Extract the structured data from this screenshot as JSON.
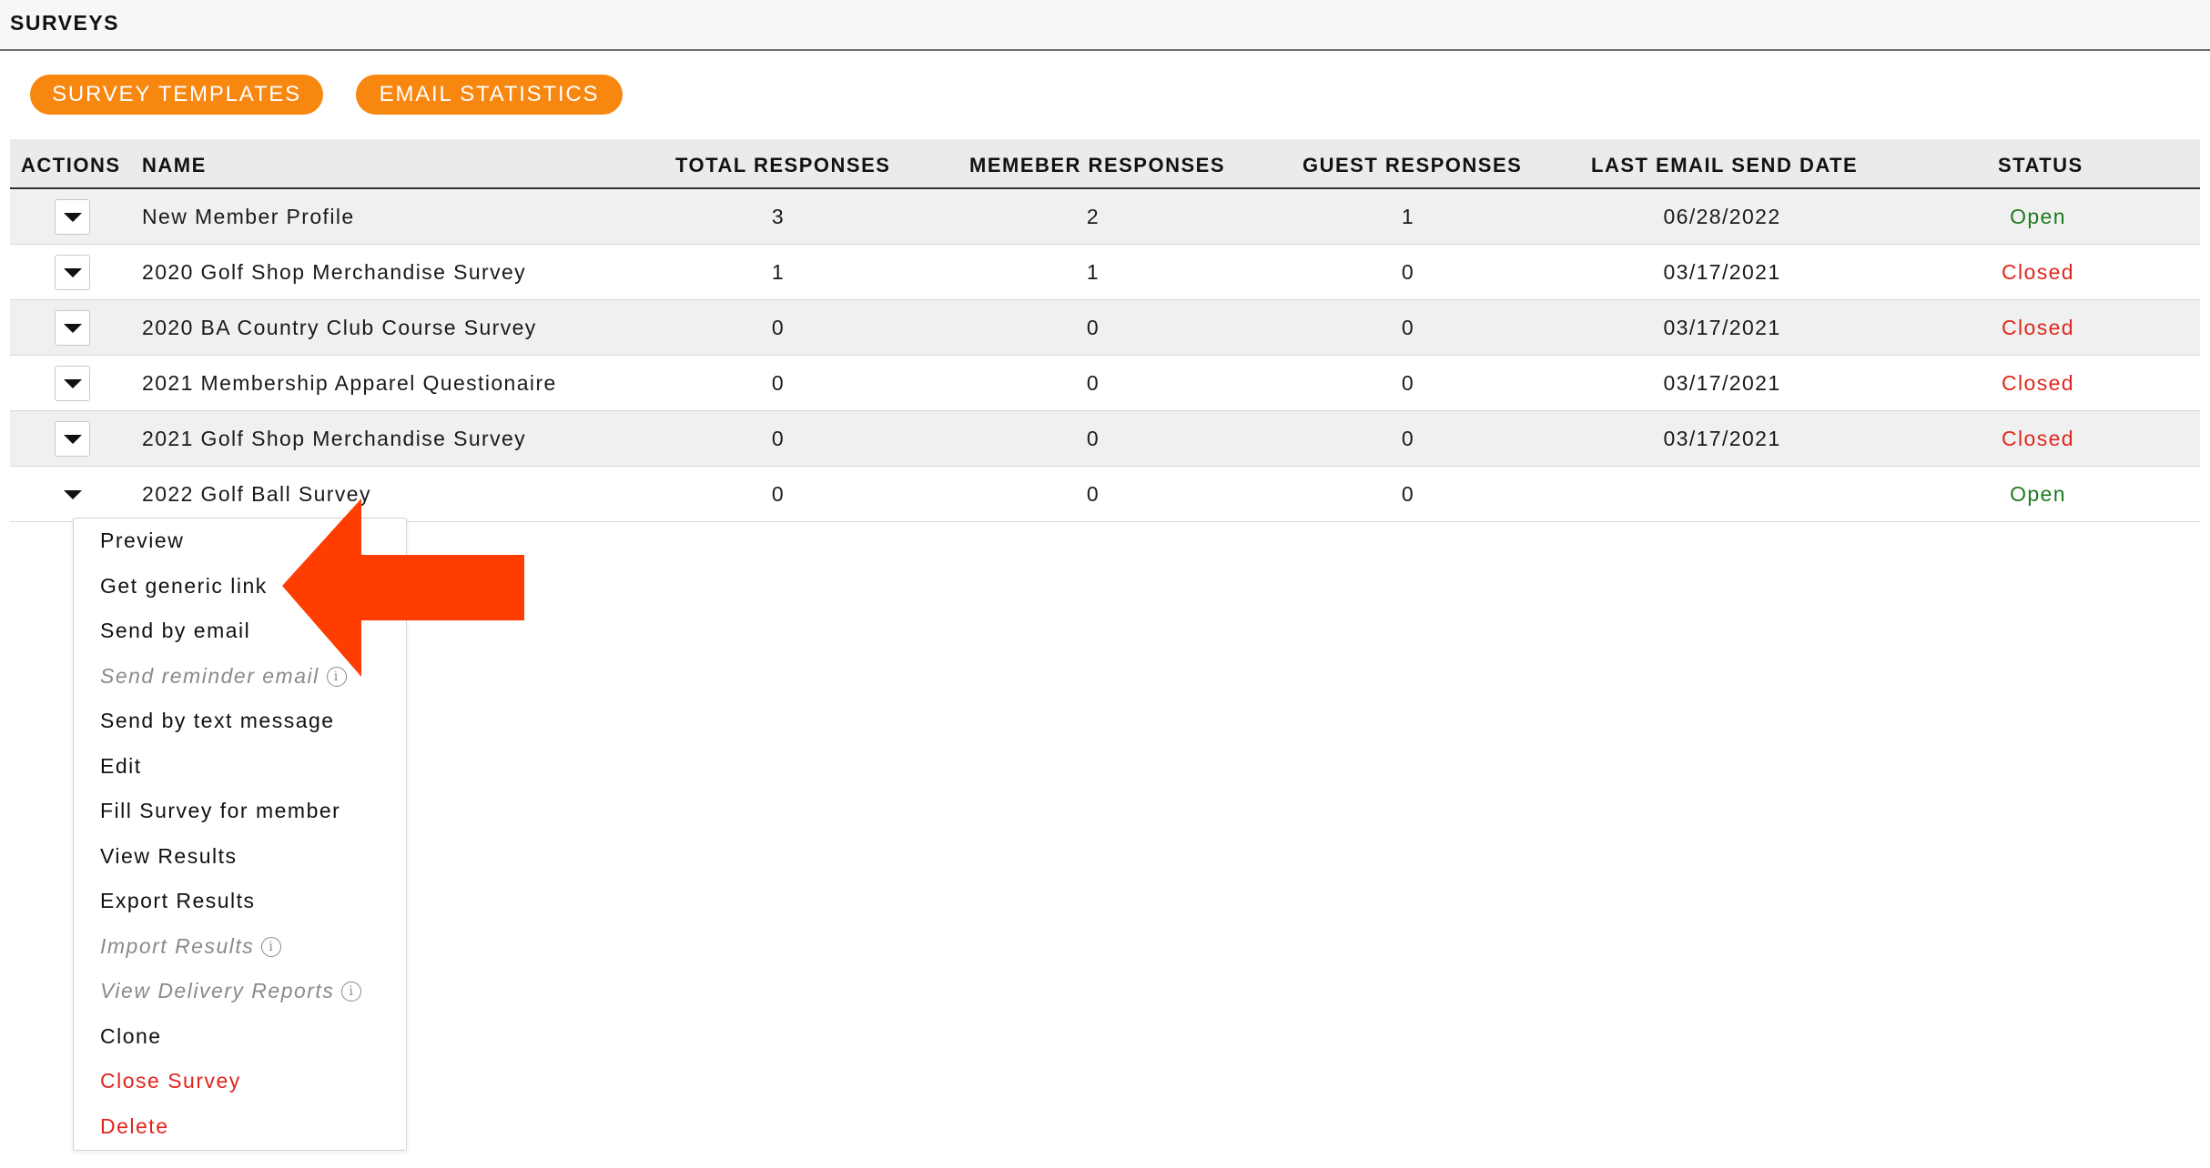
{
  "page": {
    "title": "SURVEYS"
  },
  "toolbar": {
    "templates_label": "SURVEY TEMPLATES",
    "stats_label": "EMAIL STATISTICS"
  },
  "table": {
    "headers": {
      "actions": "ACTIONS",
      "name": "NAME",
      "total": "TOTAL RESPONSES",
      "member": "MEMEBER RESPONSES",
      "guest": "GUEST RESPONSES",
      "last_email": "LAST EMAIL SEND DATE",
      "status": "STATUS"
    },
    "rows": [
      {
        "name": "New Member Profile",
        "total": "3",
        "member": "2",
        "guest": "1",
        "last_email": "06/28/2022",
        "status": "Open"
      },
      {
        "name": "2020 Golf Shop Merchandise Survey",
        "total": "1",
        "member": "1",
        "guest": "0",
        "last_email": "03/17/2021",
        "status": "Closed"
      },
      {
        "name": "2020 BA Country Club Course Survey",
        "total": "0",
        "member": "0",
        "guest": "0",
        "last_email": "03/17/2021",
        "status": "Closed"
      },
      {
        "name": "2021 Membership Apparel Questionaire",
        "total": "0",
        "member": "0",
        "guest": "0",
        "last_email": "03/17/2021",
        "status": "Closed"
      },
      {
        "name": "2021 Golf Shop Merchandise Survey",
        "total": "0",
        "member": "0",
        "guest": "0",
        "last_email": "03/17/2021",
        "status": "Closed"
      },
      {
        "name": "2022 Golf Ball Survey",
        "total": "0",
        "member": "0",
        "guest": "0",
        "last_email": "",
        "status": "Open"
      }
    ]
  },
  "actions_menu": {
    "items": [
      {
        "label": "Preview",
        "state": "normal"
      },
      {
        "label": "Get generic link",
        "state": "normal"
      },
      {
        "label": "Send by email",
        "state": "normal"
      },
      {
        "label": "Send reminder email",
        "state": "disabled"
      },
      {
        "label": "Send by text message",
        "state": "normal"
      },
      {
        "label": "Edit",
        "state": "normal"
      },
      {
        "label": "Fill Survey for member",
        "state": "normal"
      },
      {
        "label": "View Results",
        "state": "normal"
      },
      {
        "label": "Export Results",
        "state": "normal"
      },
      {
        "label": "Import Results",
        "state": "disabled"
      },
      {
        "label": "View Delivery Reports",
        "state": "disabled"
      },
      {
        "label": "Clone",
        "state": "normal"
      },
      {
        "label": "Close Survey",
        "state": "danger"
      },
      {
        "label": "Delete",
        "state": "danger"
      }
    ],
    "info_glyph": "i"
  },
  "colors": {
    "accent": "#f7870f",
    "open": "#1f7a1f",
    "closed": "#e0261c",
    "annotation_arrow": "#ff3d00"
  },
  "icons": {
    "row_toggle": "caret-down-icon",
    "info": "info-circle-icon",
    "annotation": "arrow-left-icon"
  }
}
